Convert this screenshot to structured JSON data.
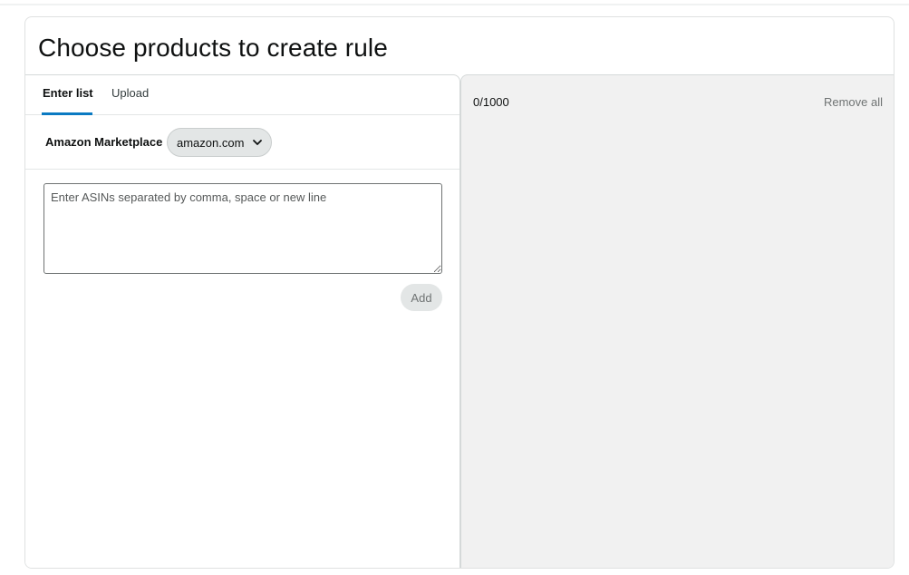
{
  "page": {
    "title": "Choose products to create rule"
  },
  "tabs": [
    {
      "label": "Enter list",
      "active": true
    },
    {
      "label": "Upload",
      "active": false
    }
  ],
  "marketplace": {
    "label": "Amazon Marketplace",
    "selected": "amazon.com",
    "icon": "chevron-down-icon"
  },
  "asin_input": {
    "placeholder": "Enter ASINs separated by comma, space or new line",
    "value": ""
  },
  "add_button": {
    "label": "Add"
  },
  "selection": {
    "count": "0/1000",
    "remove_all_label": "Remove all"
  },
  "colors": {
    "tab_accent": "#0a7ac2",
    "panel_bg": "#f1f1f1",
    "button_bg": "#e3e6e6"
  }
}
